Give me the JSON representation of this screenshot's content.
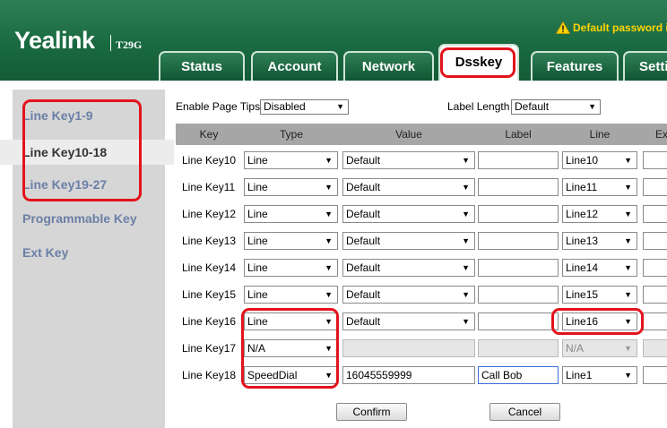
{
  "header": {
    "brand": "Yealink",
    "model": "T29G",
    "warning": "Default password is"
  },
  "tabs": [
    {
      "label": "Status"
    },
    {
      "label": "Account"
    },
    {
      "label": "Network"
    },
    {
      "label": "Dsskey",
      "active": true
    },
    {
      "label": "Features"
    },
    {
      "label": "Setti"
    }
  ],
  "sidebar": {
    "items": [
      {
        "label": "Line Key1-9"
      },
      {
        "label": "Line Key10-18",
        "selected": true
      },
      {
        "label": "Line Key19-27"
      },
      {
        "label": "Programmable Key"
      },
      {
        "label": "Ext Key"
      }
    ]
  },
  "options": {
    "page_tips_label": "Enable Page Tips",
    "page_tips_value": "Disabled",
    "label_length_label": "Label Length",
    "label_length_value": "Default"
  },
  "table": {
    "headers": [
      "Key",
      "Type",
      "Value",
      "Label",
      "Line",
      "Ex"
    ],
    "rows": [
      {
        "key": "Line Key10",
        "type": "Line",
        "value": "Default",
        "label": "",
        "line": "Line10"
      },
      {
        "key": "Line Key11",
        "type": "Line",
        "value": "Default",
        "label": "",
        "line": "Line11"
      },
      {
        "key": "Line Key12",
        "type": "Line",
        "value": "Default",
        "label": "",
        "line": "Line12"
      },
      {
        "key": "Line Key13",
        "type": "Line",
        "value": "Default",
        "label": "",
        "line": "Line13"
      },
      {
        "key": "Line Key14",
        "type": "Line",
        "value": "Default",
        "label": "",
        "line": "Line14"
      },
      {
        "key": "Line Key15",
        "type": "Line",
        "value": "Default",
        "label": "",
        "line": "Line15"
      },
      {
        "key": "Line Key16",
        "type": "Line",
        "value": "Default",
        "label": "",
        "line": "Line16"
      },
      {
        "key": "Line Key17",
        "type": "N/A",
        "value": "",
        "label": "",
        "line": "N/A"
      },
      {
        "key": "Line Key18",
        "type": "SpeedDial",
        "value": "16045559999",
        "label": "Call Bob",
        "line": "Line1"
      }
    ]
  },
  "buttons": {
    "confirm": "Confirm",
    "cancel": "Cancel"
  },
  "colors": {
    "header_green": "#1a6a41",
    "highlight_red": "#e3131c",
    "warning_yellow": "#ffd400",
    "sidebar_link": "#6b7fa6"
  }
}
